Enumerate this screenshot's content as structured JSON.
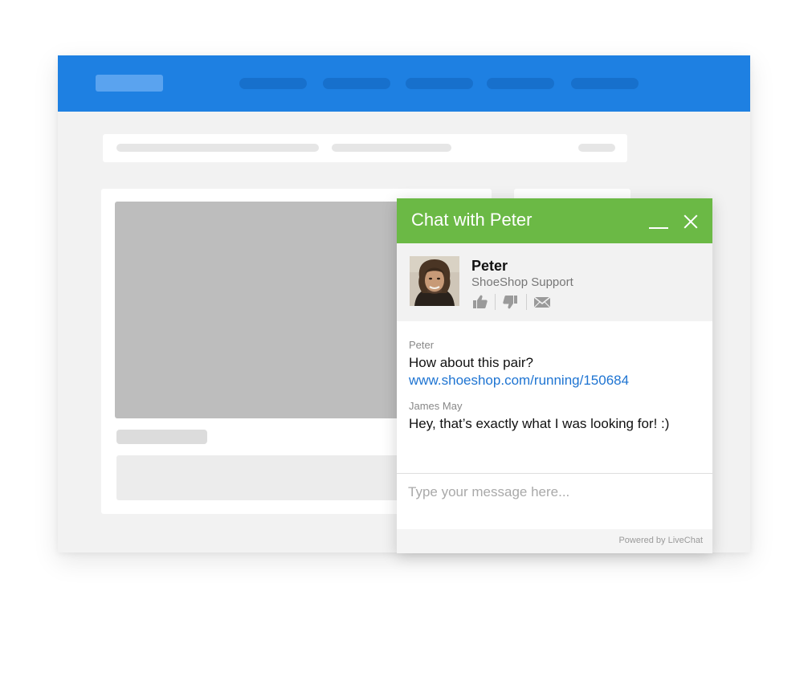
{
  "chat": {
    "title": "Chat with Peter",
    "agent": {
      "name": "Peter",
      "role": "ShoeShop Support"
    },
    "actions": [
      "thumbs-up-icon",
      "thumbs-down-icon",
      "envelope-icon"
    ],
    "messages": [
      {
        "author": "Peter",
        "text": "How about this pair?",
        "link": "www.shoeshop.com/running/150684"
      },
      {
        "author": "James May",
        "text": "Hey, that’s exactly what I was looking for! :)"
      }
    ],
    "input_placeholder": "Type your message here...",
    "footer": "Powered by LiveChat"
  },
  "colors": {
    "topbar": "#1e80e2",
    "chat_header": "#6bb945",
    "link": "#1e74d2"
  }
}
